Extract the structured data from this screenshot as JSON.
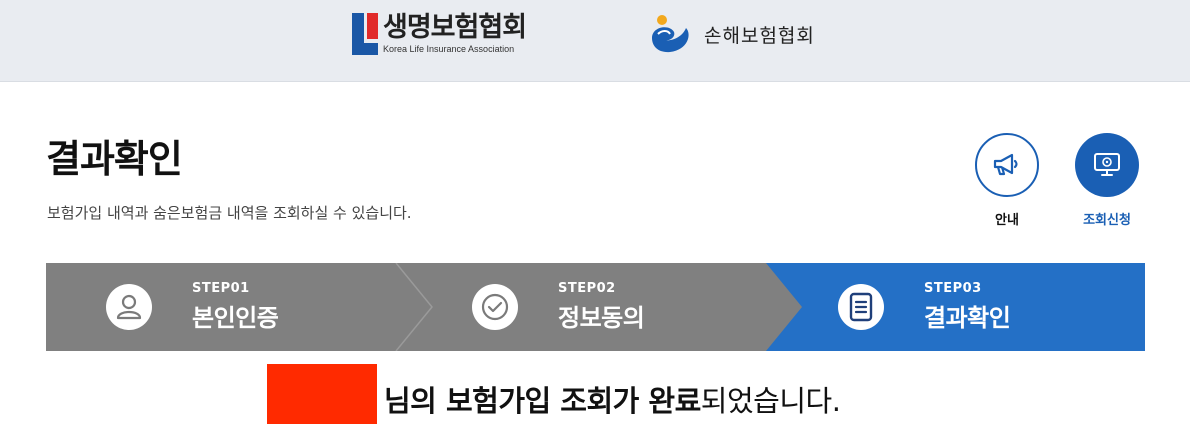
{
  "header": {
    "life_assoc": {
      "name_ko": "생명보험협회",
      "name_en": "Korea Life Insurance Association"
    },
    "nonlife_assoc": {
      "name_ko": "손해보험협회"
    }
  },
  "page": {
    "title": "결과확인",
    "description": "보험가입 내역과 숨은보험금 내역을 조회하실 수 있습니다."
  },
  "actions": {
    "guide_label": "안내",
    "apply_label": "조회신청"
  },
  "steps": [
    {
      "num": "STEP01",
      "name": "본인인증",
      "state": "done"
    },
    {
      "num": "STEP02",
      "name": "정보동의",
      "state": "done"
    },
    {
      "num": "STEP03",
      "name": "결과확인",
      "state": "active"
    }
  ],
  "result": {
    "suffix_1": "님의 ",
    "bold_1": "보험가입 조회가 완료",
    "suffix_2": "되었습니다."
  },
  "colors": {
    "brand_blue": "#1a5fb4",
    "step_done": "#808080",
    "step_active": "#2470c6",
    "redaction": "#ff2a00"
  }
}
